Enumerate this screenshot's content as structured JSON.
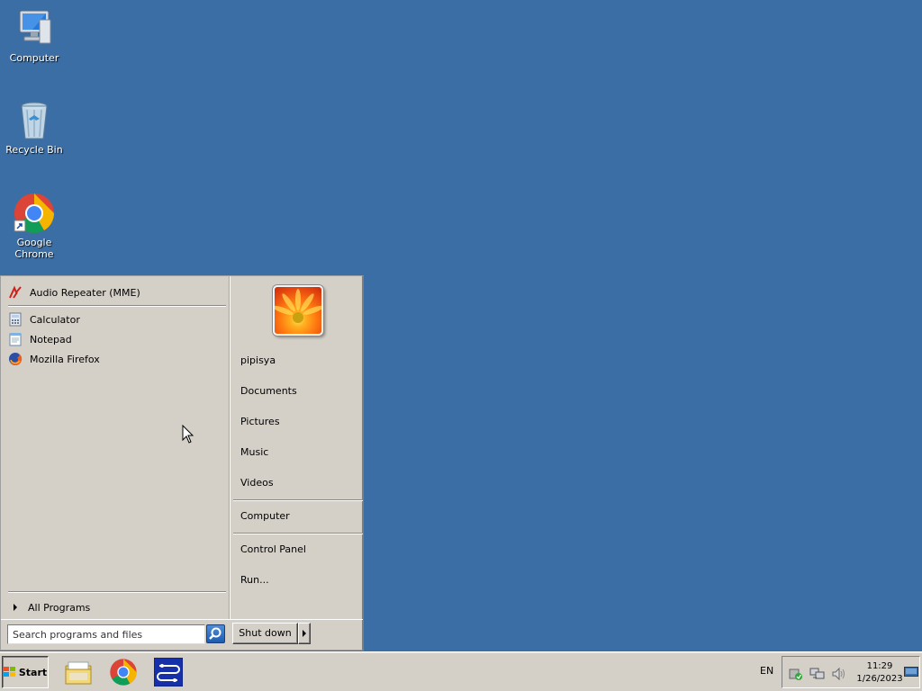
{
  "desktop": {
    "icons": [
      {
        "label": "Computer",
        "icon": "computer-icon"
      },
      {
        "label": "Recycle Bin",
        "icon": "recycle-bin-icon"
      },
      {
        "label": "Google Chrome",
        "icon": "chrome-icon"
      }
    ],
    "background_color": "#3b6ea5"
  },
  "start_menu": {
    "pinned": [
      {
        "label": "Audio Repeater (MME)",
        "icon": "audio-repeater-icon"
      }
    ],
    "recent": [
      {
        "label": "Calculator",
        "icon": "calculator-icon"
      },
      {
        "label": "Notepad",
        "icon": "notepad-icon"
      },
      {
        "label": "Mozilla Firefox",
        "icon": "firefox-icon"
      }
    ],
    "all_programs_label": "All Programs",
    "right_items": [
      {
        "label": "pipisya"
      },
      {
        "label": "Documents"
      },
      {
        "label": "Pictures"
      },
      {
        "label": "Music"
      },
      {
        "label": "Videos"
      },
      {
        "label": "Computer"
      },
      {
        "label": "Control Panel"
      },
      {
        "label": "Run..."
      }
    ],
    "search_placeholder": "Search programs and files",
    "shutdown_label": "Shut down"
  },
  "taskbar": {
    "start_label": "Start",
    "pinned_apps": [
      {
        "name": "windows-explorer-icon"
      },
      {
        "name": "chrome-icon"
      },
      {
        "name": "audio-repeater-icon"
      }
    ],
    "language": "EN",
    "clock_time": "11:29",
    "clock_date": "1/26/2023"
  }
}
